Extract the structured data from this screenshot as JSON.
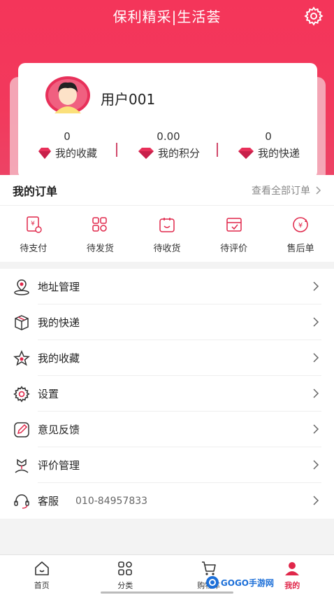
{
  "header": {
    "title": "保利精采|生活荟",
    "settings_icon": "gear-icon"
  },
  "profile": {
    "username": "用户001",
    "stats": [
      {
        "value": "0",
        "label": "我的收藏",
        "icon": "gem-icon"
      },
      {
        "value": "0.00",
        "label": "我的积分",
        "icon": "gem-icon"
      },
      {
        "value": "0",
        "label": "我的快递",
        "icon": "gem-icon"
      }
    ]
  },
  "orders": {
    "title": "我的订单",
    "view_all": "查看全部订单",
    "items": [
      {
        "label": "待支付",
        "icon": "pay-icon"
      },
      {
        "label": "待发货",
        "icon": "ship-icon"
      },
      {
        "label": "待收货",
        "icon": "receive-icon"
      },
      {
        "label": "待评价",
        "icon": "review-icon"
      },
      {
        "label": "售后单",
        "icon": "aftersale-icon"
      }
    ]
  },
  "menu": [
    {
      "label": "地址管理",
      "icon": "location-icon"
    },
    {
      "label": "我的快递",
      "icon": "package-icon"
    },
    {
      "label": "我的收藏",
      "icon": "star-icon"
    },
    {
      "label": "设置",
      "icon": "gear-icon"
    },
    {
      "label": "意见反馈",
      "icon": "feedback-icon"
    },
    {
      "label": "评价管理",
      "icon": "flower-icon"
    },
    {
      "label": "客服",
      "sub": "010-84957833",
      "icon": "headset-icon"
    }
  ],
  "tabbar": [
    {
      "label": "首页",
      "icon": "home-icon"
    },
    {
      "label": "分类",
      "icon": "category-icon"
    },
    {
      "label": "购物车",
      "icon": "cart-icon"
    },
    {
      "label": "我的",
      "icon": "user-icon",
      "active": true
    }
  ],
  "watermark": "GOGO手游网",
  "colors": {
    "accent": "#f2395c",
    "active_tab": "#e0274a"
  }
}
